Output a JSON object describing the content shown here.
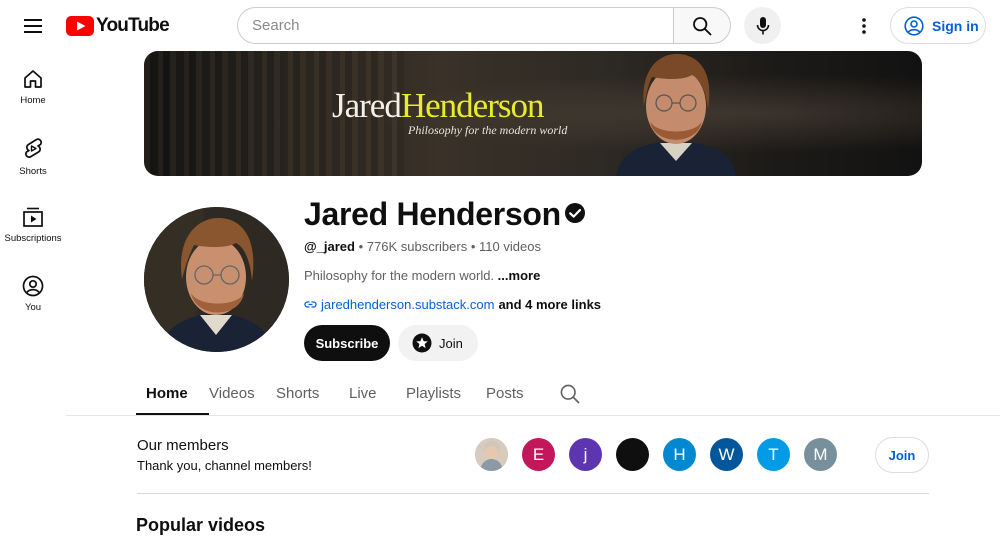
{
  "topbar": {
    "logo_text": "YouTube",
    "search_placeholder": "Search",
    "signin_label": "Sign in",
    "icons": [
      "menu-icon",
      "youtube-logo-icon",
      "search-icon",
      "microphone-icon",
      "more-vert-icon",
      "account-circle-icon"
    ],
    "brand_color": "#ff0000",
    "link_color": "#065fd4"
  },
  "sidebar": {
    "items": [
      {
        "label": "Home",
        "icon": "home-icon"
      },
      {
        "label": "Shorts",
        "icon": "shorts-icon"
      },
      {
        "label": "Subscriptions",
        "icon": "subscriptions-icon"
      },
      {
        "label": "You",
        "icon": "you-icon"
      }
    ]
  },
  "banner": {
    "title_first": "Jared",
    "title_last": "Henderson",
    "subtitle": "Philosophy for the modern world",
    "title_accent_color": "#e8ec2c"
  },
  "channel": {
    "name": "Jared Henderson",
    "verified": true,
    "handle": "@_jared",
    "subscribers": "776K subscribers",
    "videos": "110 videos",
    "description": "Philosophy for the modern world.",
    "description_more": "...more",
    "link_url_text": "jaredhenderson.substack.com",
    "link_more": "and 4 more links",
    "subscribe_label": "Subscribe",
    "join_label": "Join"
  },
  "tabs": [
    {
      "label": "Home",
      "active": true
    },
    {
      "label": "Videos",
      "active": false
    },
    {
      "label": "Shorts",
      "active": false
    },
    {
      "label": "Live",
      "active": false
    },
    {
      "label": "Playlists",
      "active": false
    },
    {
      "label": "Posts",
      "active": false
    }
  ],
  "members": {
    "title": "Our members",
    "subtitle": "Thank you, channel members!",
    "join_label": "Join",
    "avatars": [
      {
        "letter": "",
        "color": "#c9b8a8",
        "photo": true
      },
      {
        "letter": "E",
        "color": "#c2185b"
      },
      {
        "letter": "j",
        "color": "#5e35b1"
      },
      {
        "letter": "",
        "color": "#0f0f0f"
      },
      {
        "letter": "H",
        "color": "#0288d1"
      },
      {
        "letter": "W",
        "color": "#01579b"
      },
      {
        "letter": "T",
        "color": "#039be5"
      },
      {
        "letter": "M",
        "color": "#78909c"
      }
    ]
  },
  "sections": {
    "popular_title": "Popular videos"
  }
}
